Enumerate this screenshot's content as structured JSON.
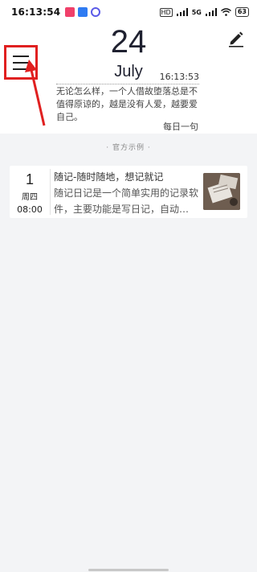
{
  "status_bar": {
    "time": "16:13:54",
    "network_labels": [
      "HD",
      "5G",
      "HD"
    ],
    "battery": "63"
  },
  "header": {
    "day": "24",
    "month": "July",
    "clock": "16:13:53",
    "quote": "无论怎么样，一个人借故堕落总是不值得原谅的，越是没有人爱，越要爱自己。",
    "quote_source": "每日一句"
  },
  "section_title": "· 官方示例 ·",
  "entries": [
    {
      "date": "1",
      "weekday": "周四",
      "time": "08:00",
      "title": "随记-随时随地，想记就记",
      "body": "随记日记是一个简单实用的记录软件，主要功能是写日记，自动…"
    }
  ],
  "colors": {
    "annotation_red": "#e02020",
    "text_dark": "#1f2130",
    "background": "#f3f4f6"
  },
  "icons": [
    "menu-icon",
    "edit-pencil-icon",
    "wifi-icon",
    "signal-icon",
    "battery-icon"
  ]
}
